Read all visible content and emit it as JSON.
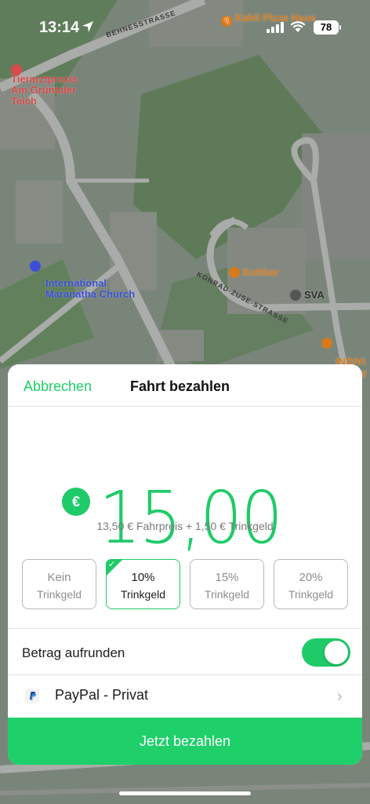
{
  "status_bar": {
    "time": "13:14",
    "battery": "78"
  },
  "map": {
    "pois": {
      "kahil": "Kahil Pizza Haus",
      "tierarzt": "Tierarztpraxis\nAm Grüntaler\nTeich",
      "church": "International\nMaranatha Church",
      "kuhbar": "Kuhbar",
      "sva": "SVA",
      "individ": "INDIVI\nBenny"
    },
    "streets": {
      "behnes": "BEHNESSTRASSE",
      "konrad": "KONRAD-ZUSE-STRASSE"
    }
  },
  "sheet": {
    "cancel_label": "Abbrechen",
    "title": "Fahrt bezahlen",
    "currency_symbol": "€",
    "amount": "15,00",
    "breakdown": "13,50 € Fahrpreis + 1,50 € Trinkgeld",
    "tips": [
      {
        "line1": "Kein",
        "line2": "Trinkgeld",
        "selected": false
      },
      {
        "line1": "10%",
        "line2": "Trinkgeld",
        "selected": true
      },
      {
        "line1": "15%",
        "line2": "Trinkgeld",
        "selected": false
      },
      {
        "line1": "20%",
        "line2": "Trinkgeld",
        "selected": false
      }
    ],
    "roundup_label": "Betrag aufrunden",
    "roundup_enabled": true,
    "payment_method": "PayPal - Privat",
    "pay_button_label": "Jetzt bezahlen"
  },
  "colors": {
    "accent": "#1ecb68",
    "pay_button": "#1fcf6a",
    "poi_orange": "#d67a1c",
    "poi_red": "#d94a4a",
    "poi_blue": "#3a4fd6"
  }
}
